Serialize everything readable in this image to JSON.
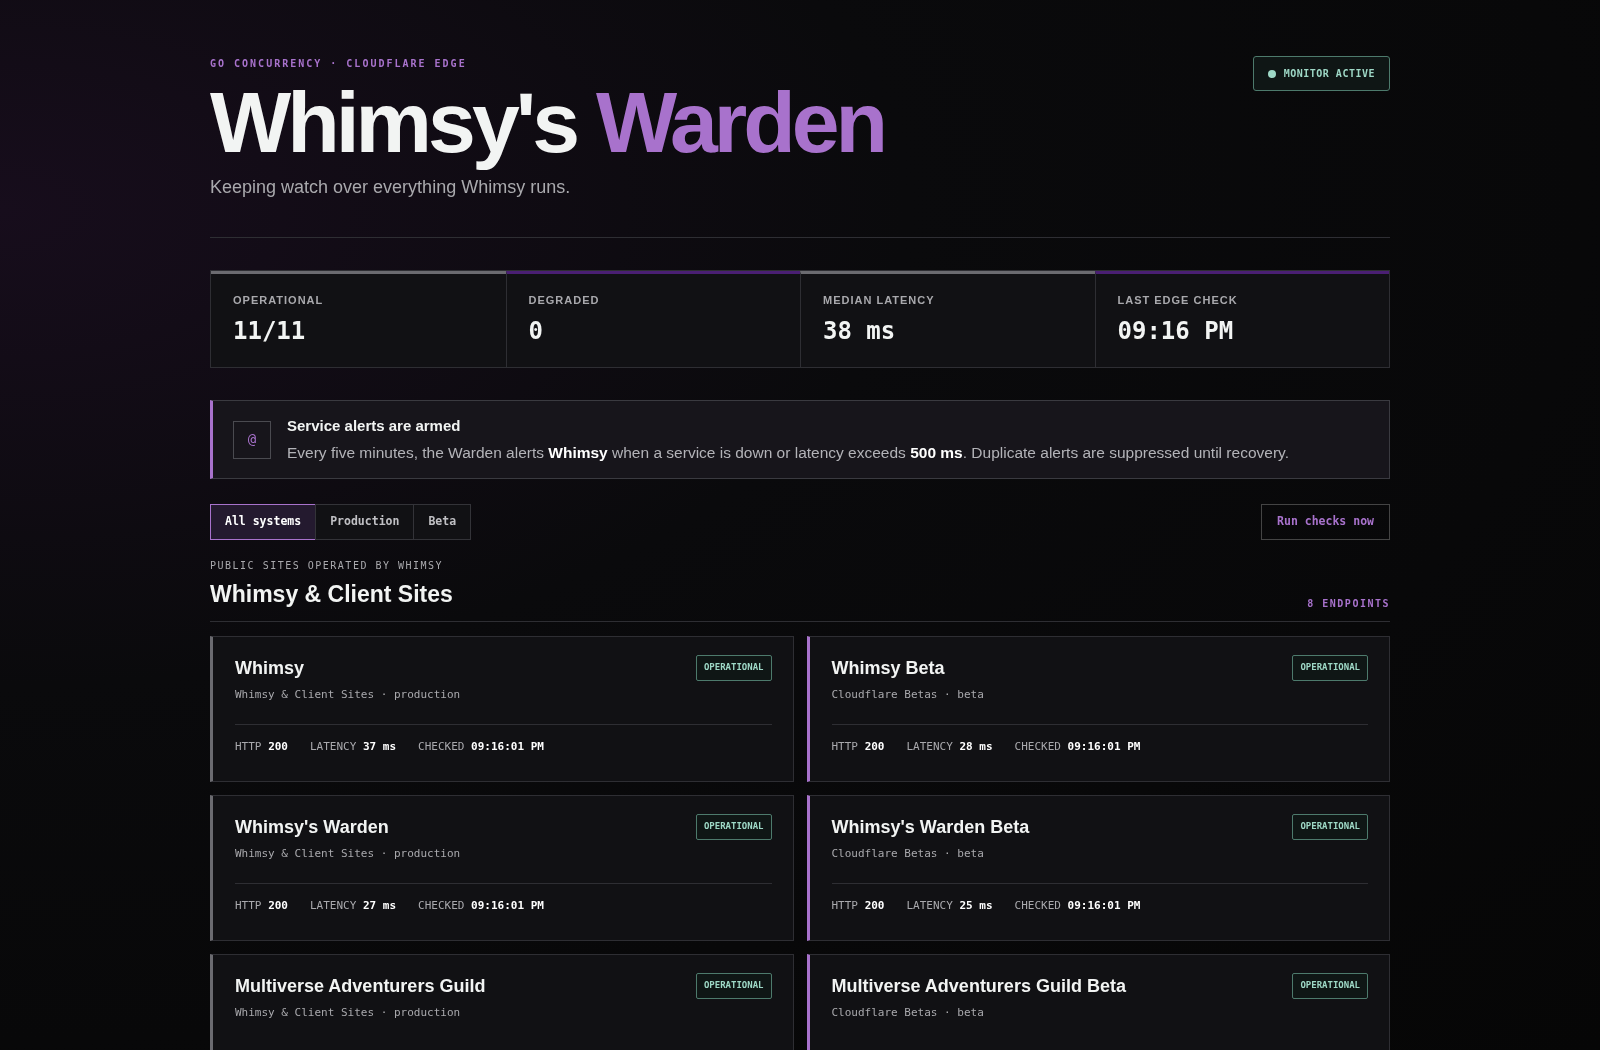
{
  "header": {
    "eyebrow": "GO CONCURRENCY · CLOUDFLARE EDGE",
    "title_main": "Whimsy's",
    "title_accent": "Warden",
    "subtitle": "Keeping watch over everything Whimsy runs.",
    "monitor": {
      "label": "MONITOR ACTIVE",
      "on": true
    }
  },
  "stats": [
    {
      "label": "OPERATIONAL",
      "value": "11/11",
      "color": "#6b6b70"
    },
    {
      "label": "DEGRADED",
      "value": "0",
      "color": "#4a1f73"
    },
    {
      "label": "MEDIAN LATENCY",
      "value": "38 ms",
      "color": "#6b6b70"
    },
    {
      "label": "LAST EDGE CHECK",
      "value": "09:16 PM",
      "color": "#4a1f73"
    }
  ],
  "alert": {
    "icon": "@",
    "title": "Service alerts are armed",
    "text": "Every five minutes, the Warden alerts **Whimsy** when a service is down or latency exceeds **500 ms**. Duplicate alerts are suppressed until recovery."
  },
  "filters": [
    {
      "label": "All systems",
      "selected": true
    },
    {
      "label": "Production",
      "selected": false
    },
    {
      "label": "Beta",
      "selected": false
    }
  ],
  "run_button": "Run checks now",
  "section": {
    "eyebrow": "PUBLIC SITES OPERATED BY WHIMSY",
    "title": "Whimsy & Client Sites",
    "count": "8 ENDPOINTS",
    "endpoints": [
      {
        "name": "Whimsy",
        "meta": "Whimsy & Client Sites · production",
        "kind": "production",
        "status": "OPERATIONAL",
        "metrics": [
          {
            "label": "HTTP",
            "value": "200"
          },
          {
            "label": "LATENCY",
            "value": "37 ms"
          },
          {
            "label": "CHECKED",
            "value": "09:16:01 PM"
          }
        ]
      },
      {
        "name": "Whimsy Beta",
        "meta": "Cloudflare Betas · beta",
        "kind": "beta",
        "status": "OPERATIONAL",
        "metrics": [
          {
            "label": "HTTP",
            "value": "200"
          },
          {
            "label": "LATENCY",
            "value": "28 ms"
          },
          {
            "label": "CHECKED",
            "value": "09:16:01 PM"
          }
        ]
      },
      {
        "name": "Whimsy's Warden",
        "meta": "Whimsy & Client Sites · production",
        "kind": "production",
        "status": "OPERATIONAL",
        "metrics": [
          {
            "label": "HTTP",
            "value": "200"
          },
          {
            "label": "LATENCY",
            "value": "27 ms"
          },
          {
            "label": "CHECKED",
            "value": "09:16:01 PM"
          }
        ]
      },
      {
        "name": "Whimsy's Warden Beta",
        "meta": "Cloudflare Betas · beta",
        "kind": "beta",
        "status": "OPERATIONAL",
        "metrics": [
          {
            "label": "HTTP",
            "value": "200"
          },
          {
            "label": "LATENCY",
            "value": "25 ms"
          },
          {
            "label": "CHECKED",
            "value": "09:16:01 PM"
          }
        ]
      },
      {
        "name": "Multiverse Adventurers Guild",
        "meta": "Whimsy & Client Sites · production",
        "kind": "production",
        "status": "OPERATIONAL"
      },
      {
        "name": "Multiverse Adventurers Guild Beta",
        "meta": "Cloudflare Betas · beta",
        "kind": "beta",
        "status": "OPERATIONAL"
      }
    ]
  }
}
